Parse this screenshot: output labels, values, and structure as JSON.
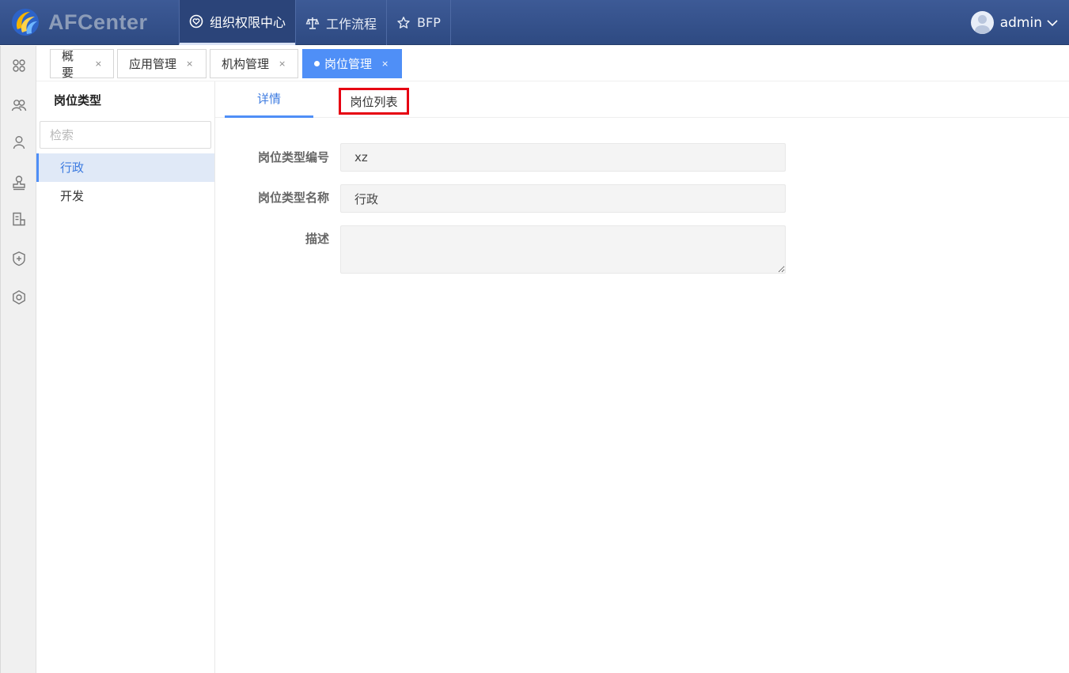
{
  "header": {
    "app_title": "AFCenter",
    "nav": [
      {
        "label": "组织权限中心",
        "icon": "heart-icon",
        "active": true
      },
      {
        "label": "工作流程",
        "icon": "balance-icon",
        "active": false
      },
      {
        "label": "BFP",
        "icon": "star-icon",
        "active": false
      }
    ],
    "user": {
      "name": "admin"
    }
  },
  "rail": {
    "icons": [
      "apps-icon",
      "group-icon",
      "user-icon",
      "stamp-icon",
      "report-icon",
      "shield-plus-icon",
      "settings-icon"
    ]
  },
  "tabs": [
    {
      "label": "概要",
      "close": "×",
      "active": false
    },
    {
      "label": "应用管理",
      "close": "×",
      "active": false
    },
    {
      "label": "机构管理",
      "close": "×",
      "active": false
    },
    {
      "label": "岗位管理",
      "close": "×",
      "active": true
    }
  ],
  "tree": {
    "title": "岗位类型",
    "search_placeholder": "检索",
    "items": [
      {
        "label": "行政",
        "selected": true
      },
      {
        "label": "开发",
        "selected": false
      }
    ]
  },
  "subtabs": [
    {
      "label": "详情",
      "active": true
    },
    {
      "label": "岗位列表",
      "active": false
    }
  ],
  "form": {
    "code_label": "岗位类型编号",
    "code_value": "xz",
    "name_label": "岗位类型名称",
    "name_value": "行政",
    "desc_label": "描述",
    "desc_value": ""
  },
  "colors": {
    "header_bg": "#34508a",
    "accent": "#4f8ff7",
    "highlight_box": "#e60012"
  }
}
